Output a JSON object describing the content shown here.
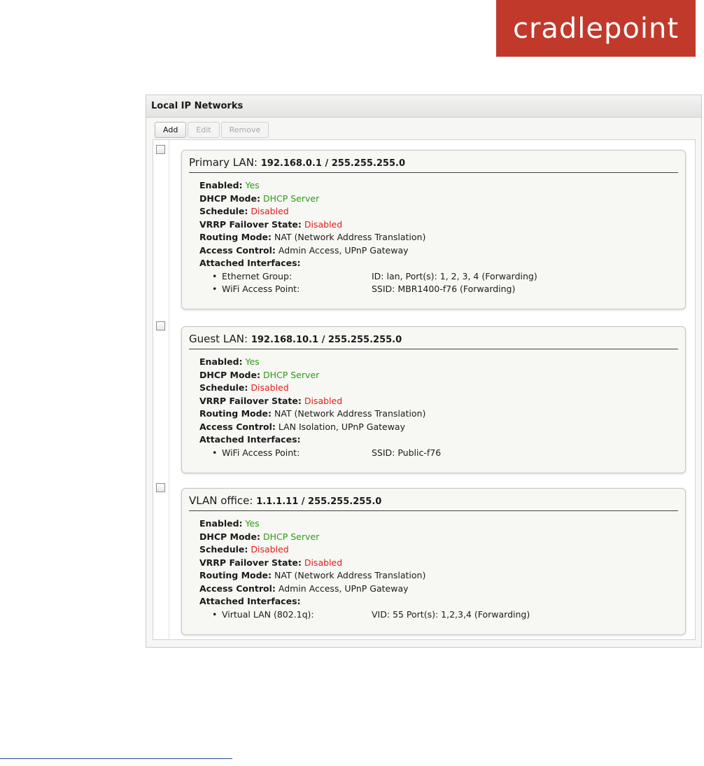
{
  "logo": "cradlepoint",
  "panel": {
    "title": "Local IP Networks",
    "toolbar": {
      "add": "Add",
      "edit": "Edit",
      "remove": "Remove"
    }
  },
  "networks": [
    {
      "name": "Primary LAN:",
      "address": "192.168.0.1 / 255.255.255.0",
      "enabled_label": "Enabled:",
      "enabled": "Yes",
      "dhcp_label": "DHCP Mode:",
      "dhcp": "DHCP Server",
      "schedule_label": "Schedule:",
      "schedule": "Disabled",
      "vrrp_label": "VRRP Failover State:",
      "vrrp": "Disabled",
      "routing_label": "Routing Mode:",
      "routing": "NAT (Network Address Translation)",
      "access_label": "Access Control:",
      "access": "Admin Access, UPnP Gateway",
      "interfaces_label": "Attached Interfaces:",
      "interfaces": [
        {
          "name": "Ethernet Group:",
          "detail": "ID: lan, Port(s): 1, 2, 3, 4 (Forwarding)"
        },
        {
          "name": "WiFi Access Point:",
          "detail": "SSID: MBR1400-f76 (Forwarding)"
        }
      ]
    },
    {
      "name": "Guest LAN:",
      "address": "192.168.10.1 / 255.255.255.0",
      "enabled_label": "Enabled:",
      "enabled": "Yes",
      "dhcp_label": "DHCP Mode:",
      "dhcp": "DHCP Server",
      "schedule_label": "Schedule:",
      "schedule": "Disabled",
      "vrrp_label": "VRRP Failover State:",
      "vrrp": "Disabled",
      "routing_label": "Routing Mode:",
      "routing": "NAT (Network Address Translation)",
      "access_label": "Access Control:",
      "access": "LAN Isolation, UPnP Gateway",
      "interfaces_label": "Attached Interfaces:",
      "interfaces": [
        {
          "name": "WiFi Access Point:",
          "detail": "SSID: Public-f76"
        }
      ]
    },
    {
      "name": "VLAN office:",
      "address": "1.1.1.11 / 255.255.255.0",
      "enabled_label": "Enabled:",
      "enabled": "Yes",
      "dhcp_label": "DHCP Mode:",
      "dhcp": "DHCP Server",
      "schedule_label": "Schedule:",
      "schedule": "Disabled",
      "vrrp_label": "VRRP Failover State:",
      "vrrp": "Disabled",
      "routing_label": "Routing Mode:",
      "routing": "NAT (Network Address Translation)",
      "access_label": "Access Control:",
      "access": "Admin Access, UPnP Gateway",
      "interfaces_label": "Attached Interfaces:",
      "interfaces": [
        {
          "name": "Virtual LAN (802.1q):",
          "detail": "VID: 55 Port(s): 1,2,3,4 (Forwarding)"
        }
      ]
    }
  ],
  "colors": {
    "brand": "#c0392b",
    "status_ok": "#2e9a18",
    "status_off": "#e81b1b"
  }
}
